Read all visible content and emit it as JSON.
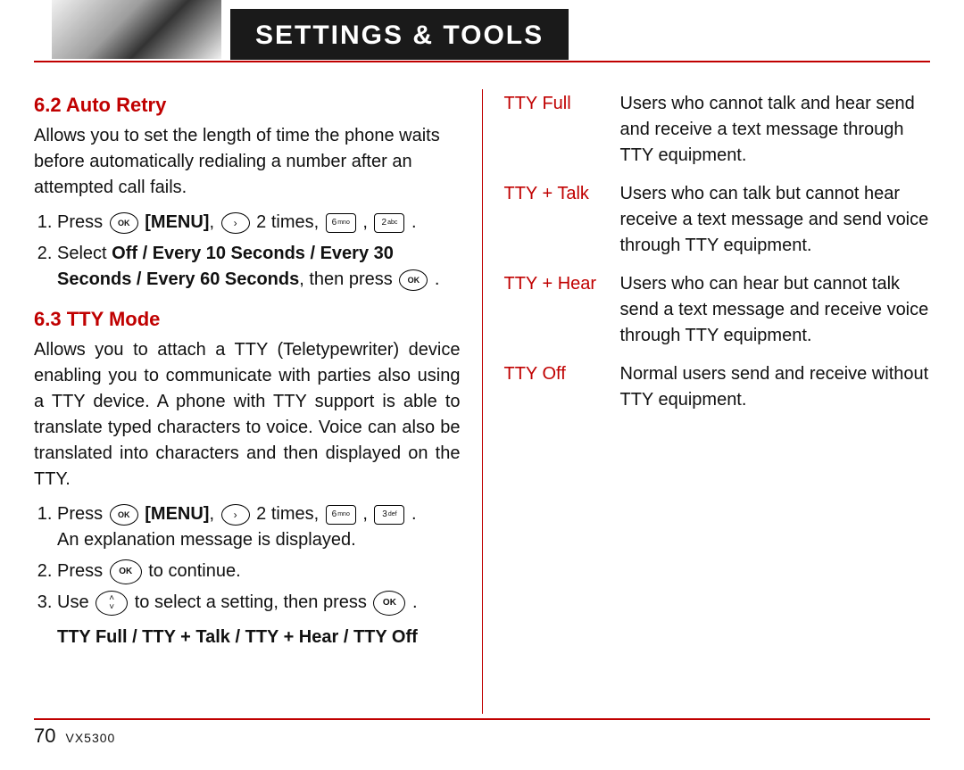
{
  "header": {
    "title": "SETTINGS & TOOLS"
  },
  "left": {
    "s62": {
      "title": "6.2 Auto Retry",
      "intro": "Allows you to set the length of time the phone waits before automatically redialing a number after an attempted call fails.",
      "step1_press": "Press",
      "step1_menu": "[MENU]",
      "step1_times": "2 times,",
      "step1_comma": ",",
      "step1_period": ".",
      "step2_a": "Select",
      "step2_opts": "Off / Every 10 Seconds / Every 30 Seconds / Every 60 Seconds",
      "step2_b": ", then press",
      "step2_end": "."
    },
    "s63": {
      "title": "6.3 TTY Mode",
      "intro": "Allows you to attach a TTY (Teletypewriter) device enabling you to communicate with parties also using a TTY device. A phone with TTY support is able to translate typed characters to voice. Voice can also be translated into characters and then displayed on the TTY.",
      "step1_press": "Press",
      "step1_menu": "[MENU]",
      "step1_times": "2 times,",
      "step1_comma": ",",
      "step1_period": ".",
      "step1_line2": "An explanation message is displayed.",
      "step2_a": "Press",
      "step2_b": "to continue.",
      "step3_a": "Use",
      "step3_b": "to select a setting, then press",
      "step3_end": ".",
      "options": "TTY Full / TTY + Talk / TTY + Hear / TTY Off"
    }
  },
  "right": {
    "rows": [
      {
        "term": "TTY Full",
        "desc": "Users who cannot  talk and hear send and receive a text message through TTY equipment."
      },
      {
        "term": "TTY + Talk",
        "desc": "Users who can talk but cannot hear receive a text message and send voice through TTY equipment."
      },
      {
        "term": "TTY + Hear",
        "desc": "Users who can hear but cannot talk send a text message and receive voice through TTY equipment."
      },
      {
        "term": "TTY Off",
        "desc": "Normal users send and receive without TTY equipment."
      }
    ]
  },
  "keys": {
    "ok": "OK",
    "nav_right": "›",
    "six": "6",
    "six_sup": "mno",
    "two": "2",
    "two_sup": "abc",
    "three": "3",
    "three_sup": "def",
    "up": "˄",
    "down": "˅"
  },
  "footer": {
    "page": "70",
    "model": "VX5300"
  }
}
